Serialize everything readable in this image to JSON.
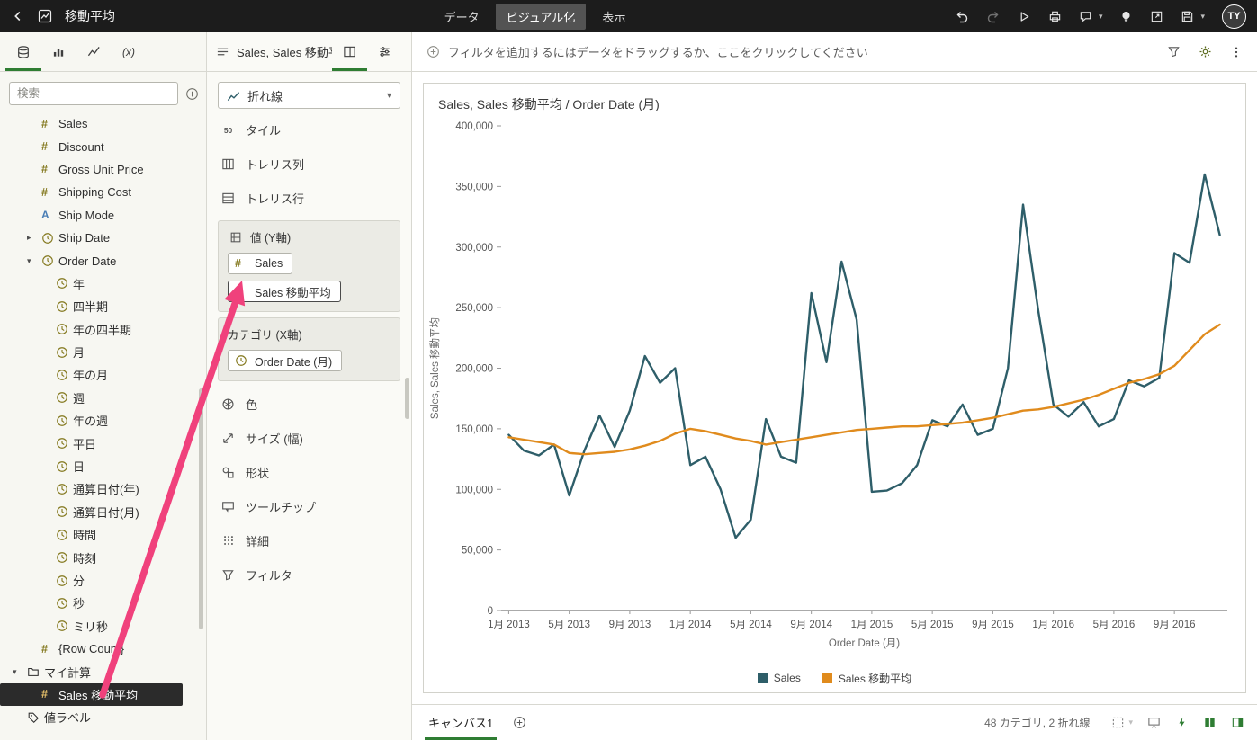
{
  "topbar": {
    "title": "移動平均",
    "tabs": [
      {
        "label": "データ",
        "active": false
      },
      {
        "label": "ビジュアル化",
        "active": true
      },
      {
        "label": "表示",
        "active": false
      }
    ],
    "avatar": "TY"
  },
  "data_panel": {
    "search_placeholder": "検索",
    "fields": [
      {
        "icon": "measure",
        "label": "Sales",
        "level": 1
      },
      {
        "icon": "measure",
        "label": "Discount",
        "level": 1
      },
      {
        "icon": "measure",
        "label": "Gross Unit Price",
        "level": 1
      },
      {
        "icon": "measure",
        "label": "Shipping Cost",
        "level": 1
      },
      {
        "icon": "attribute",
        "label": "Ship Mode",
        "level": 1
      },
      {
        "icon": "date",
        "label": "Ship Date",
        "level": 1,
        "expand": "collapsed"
      },
      {
        "icon": "date",
        "label": "Order Date",
        "level": 1,
        "expand": "expanded"
      },
      {
        "icon": "date",
        "label": "年",
        "level": 2
      },
      {
        "icon": "date",
        "label": "四半期",
        "level": 2
      },
      {
        "icon": "date",
        "label": "年の四半期",
        "level": 2
      },
      {
        "icon": "date",
        "label": "月",
        "level": 2
      },
      {
        "icon": "date",
        "label": "年の月",
        "level": 2
      },
      {
        "icon": "date",
        "label": "週",
        "level": 2
      },
      {
        "icon": "date",
        "label": "年の週",
        "level": 2
      },
      {
        "icon": "date",
        "label": "平日",
        "level": 2
      },
      {
        "icon": "date",
        "label": "日",
        "level": 2
      },
      {
        "icon": "date",
        "label": "通算日付(年)",
        "level": 2
      },
      {
        "icon": "date",
        "label": "通算日付(月)",
        "level": 2
      },
      {
        "icon": "date",
        "label": "時間",
        "level": 2
      },
      {
        "icon": "date",
        "label": "時刻",
        "level": 2
      },
      {
        "icon": "date",
        "label": "分",
        "level": 2
      },
      {
        "icon": "date",
        "label": "秒",
        "level": 2
      },
      {
        "icon": "date",
        "label": "ミリ秒",
        "level": 2
      },
      {
        "icon": "measure",
        "label": "{Row Count}",
        "level": 1
      },
      {
        "icon": "folder",
        "label": "マイ計算",
        "level": 0,
        "expand": "expanded"
      },
      {
        "icon": "measure",
        "label": "Sales 移動平均",
        "level": 1,
        "selected": true
      },
      {
        "icon": "tag",
        "label": "値ラベル",
        "level": 0
      }
    ]
  },
  "grammar_panel": {
    "title": "Sales, Sales 移動平...",
    "viz_type": "折れ線",
    "slots_top": [
      {
        "icon": "tile",
        "label": "タイル"
      },
      {
        "icon": "trellis-cols",
        "label": "トレリス列"
      },
      {
        "icon": "trellis-rows",
        "label": "トレリス行"
      }
    ],
    "value_axis": {
      "label": "値 (Y軸)",
      "chips": [
        {
          "icon": "measure",
          "label": "Sales",
          "highlight": false
        },
        {
          "icon": "measure",
          "label": "Sales 移動平均",
          "highlight": true
        }
      ]
    },
    "category_axis": {
      "label": "カテゴリ (X軸)",
      "chips": [
        {
          "icon": "date",
          "label": "Order Date (月)",
          "highlight": false
        }
      ]
    },
    "slots_bottom": [
      {
        "icon": "color",
        "label": "色"
      },
      {
        "icon": "size",
        "label": "サイズ (幅)"
      },
      {
        "icon": "shape",
        "label": "形状"
      },
      {
        "icon": "tooltip",
        "label": "ツールチップ"
      },
      {
        "icon": "detail",
        "label": "詳細"
      },
      {
        "icon": "filter",
        "label": "フィルタ"
      }
    ]
  },
  "filter_bar": {
    "prompt": "フィルタを追加するにはデータをドラッグするか、ここをクリックしてください"
  },
  "canvas_bar": {
    "tab": "キャンバス1",
    "status": "48 カテゴリ, 2 折れ線"
  },
  "chart_data": {
    "type": "line",
    "title": "Sales, Sales 移動平均 / Order Date (月)",
    "xlabel": "Order Date (月)",
    "ylabel": "Sales, Sales 移動平均",
    "ylim": [
      0,
      400000
    ],
    "ytick_step": 50000,
    "x_tick_every": 4,
    "grid": false,
    "legend_position": "bottom",
    "categories": [
      "1月 2013",
      "2月 2013",
      "3月 2013",
      "4月 2013",
      "5月 2013",
      "6月 2013",
      "7月 2013",
      "8月 2013",
      "9月 2013",
      "10月 2013",
      "11月 2013",
      "12月 2013",
      "1月 2014",
      "2月 2014",
      "3月 2014",
      "4月 2014",
      "5月 2014",
      "6月 2014",
      "7月 2014",
      "8月 2014",
      "9月 2014",
      "10月 2014",
      "11月 2014",
      "12月 2014",
      "1月 2015",
      "2月 2015",
      "3月 2015",
      "4月 2015",
      "5月 2015",
      "6月 2015",
      "7月 2015",
      "8月 2015",
      "9月 2015",
      "10月 2015",
      "11月 2015",
      "12月 2015",
      "1月 2016",
      "2月 2016",
      "3月 2016",
      "4月 2016",
      "5月 2016",
      "6月 2016",
      "7月 2016",
      "8月 2016",
      "9月 2016",
      "10月 2016",
      "11月 2016",
      "12月 2016"
    ],
    "series": [
      {
        "name": "Sales",
        "color": "#2e5e69",
        "values": [
          145000,
          132000,
          128000,
          137000,
          95000,
          132000,
          161000,
          135000,
          165000,
          210000,
          188000,
          200000,
          120000,
          127000,
          100000,
          60000,
          75000,
          158000,
          127000,
          122000,
          262000,
          205000,
          288000,
          240000,
          98000,
          99000,
          105000,
          120000,
          157000,
          152000,
          170000,
          145000,
          150000,
          200000,
          335000,
          248000,
          170000,
          160000,
          172000,
          152000,
          158000,
          190000,
          185000,
          192000,
          295000,
          287000,
          360000,
          310000
        ]
      },
      {
        "name": "Sales 移動平均",
        "color": "#e08b1d",
        "values": [
          143000,
          141000,
          139000,
          137000,
          130000,
          129000,
          130000,
          131000,
          133000,
          136000,
          140000,
          146000,
          150000,
          148000,
          145000,
          142000,
          140000,
          137000,
          139000,
          141000,
          143000,
          145000,
          147000,
          149000,
          150000,
          151000,
          152000,
          152000,
          153000,
          154000,
          155000,
          157000,
          159000,
          162000,
          165000,
          166000,
          168000,
          171000,
          174000,
          178000,
          183000,
          188000,
          191000,
          195000,
          202000,
          215000,
          228000,
          236000
        ]
      }
    ]
  }
}
